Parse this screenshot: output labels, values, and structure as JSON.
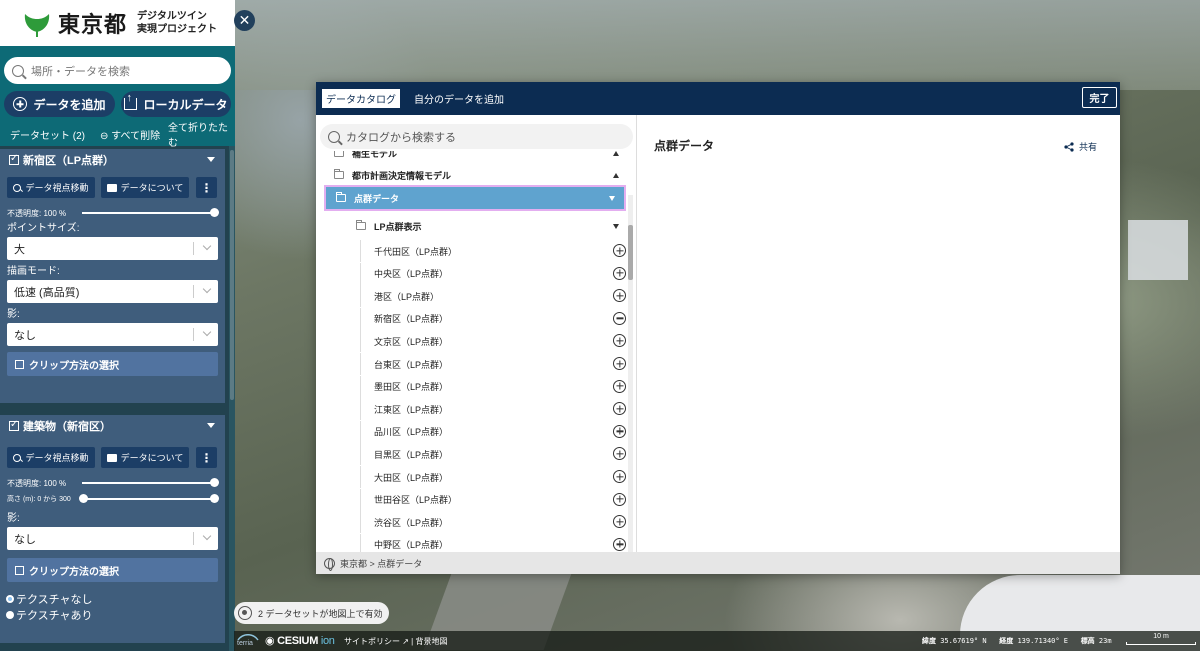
{
  "header": {
    "logo_text": "東京都",
    "logo_sub_line1": "デジタルツイン",
    "logo_sub_line2": "実現プロジェクト"
  },
  "search": {
    "placeholder": "場所・データを検索"
  },
  "actions": {
    "add_data": "データを追加",
    "local_data": "ローカルデータ"
  },
  "dataset_bar": {
    "count_label": "データセット (2)",
    "remove_all": "すべて削除",
    "collapse_all": "全て折りたたむ"
  },
  "datasets": [
    {
      "title": "新宿区（LP点群）",
      "btn_view": "データ視点移動",
      "btn_about": "データについて",
      "opacity_label": "不透明度: 100 %",
      "opacity_value": 1.0,
      "point_size_label": "ポイントサイズ:",
      "point_size_value": "大",
      "render_mode_label": "描画モード:",
      "render_mode_value": "低速 (高品質)",
      "shadow_label": "影:",
      "shadow_value": "なし",
      "clip_label": "クリップ方法の選択"
    },
    {
      "title": "建築物（新宿区）",
      "btn_view": "データ視点移動",
      "btn_about": "データについて",
      "opacity_label": "不透明度: 100 %",
      "opacity_value": 1.0,
      "height_label": "高さ (m): 0 から 300",
      "height_range": [
        0,
        300
      ],
      "shadow_label": "影:",
      "shadow_value": "なし",
      "clip_label": "クリップ方法の選択",
      "texture_options": [
        "テクスチャなし",
        "テクスチャあり"
      ],
      "texture_selected": "テクスチャなし"
    }
  ],
  "status_chip": "2 データセットが地図上で有効",
  "footer": {
    "terria": "terria",
    "cesium": "CESIUM",
    "cesium_ion": "ion",
    "links": "サイトポリシー ↗ | 背景地図",
    "lat_label": "緯度",
    "lat_value": "35.67619° N",
    "lon_label": "経度",
    "lon_value": "139.71340° E",
    "elev_label": "標高",
    "elev_value": "23m",
    "scale": "10 m"
  },
  "catalog": {
    "tab_catalog": "データカタログ",
    "tab_my_data": "自分のデータを追加",
    "done": "完了",
    "search_placeholder": "カタログから検索する",
    "tree": [
      {
        "label": "補生モデル",
        "expanded": true
      },
      {
        "label": "都市計画決定情報モデル",
        "expanded": true
      },
      {
        "label": "点群データ",
        "expanded": false,
        "selected": true
      },
      {
        "label": "LP点群表示",
        "expanded": false
      }
    ],
    "leaves": [
      {
        "label": "千代田区（LP点群）",
        "state": "add"
      },
      {
        "label": "中央区（LP点群）",
        "state": "add"
      },
      {
        "label": "港区（LP点群）",
        "state": "add"
      },
      {
        "label": "新宿区（LP点群）",
        "state": "remove"
      },
      {
        "label": "文京区（LP点群）",
        "state": "add"
      },
      {
        "label": "台東区（LP点群）",
        "state": "add"
      },
      {
        "label": "墨田区（LP点群）",
        "state": "add"
      },
      {
        "label": "江東区（LP点群）",
        "state": "add"
      },
      {
        "label": "品川区（LP点群）",
        "state": "add"
      },
      {
        "label": "目黒区（LP点群）",
        "state": "add"
      },
      {
        "label": "大田区（LP点群）",
        "state": "add"
      },
      {
        "label": "世田谷区（LP点群）",
        "state": "add"
      },
      {
        "label": "渋谷区（LP点群）",
        "state": "add"
      },
      {
        "label": "中野区（LP点群）",
        "state": "add"
      }
    ],
    "detail_title": "点群データ",
    "share": "共有",
    "breadcrumb": "東京都 > 点群データ"
  },
  "colors": {
    "brand_green": "#2e9b3a",
    "header_navy": "#0c2c52",
    "sidebar_teal": "#0d6a76",
    "selected_row": "#5fa3cf"
  }
}
